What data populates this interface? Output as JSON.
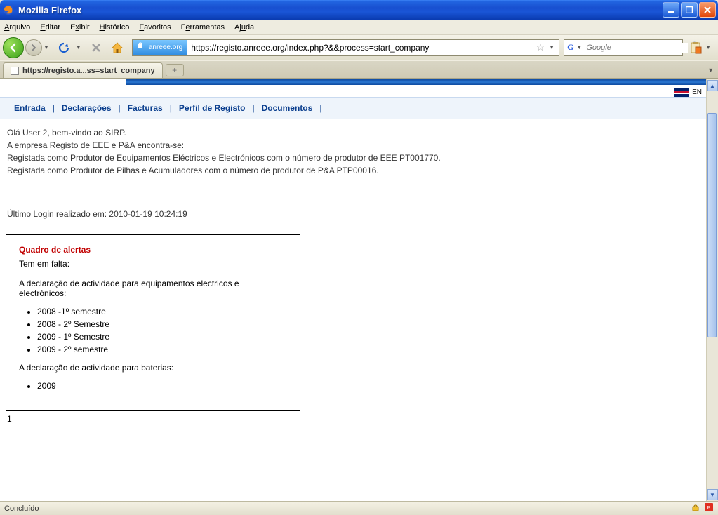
{
  "window": {
    "title": "Mozilla Firefox"
  },
  "menu": {
    "items": [
      "Arquivo",
      "Editar",
      "Exibir",
      "Histórico",
      "Favoritos",
      "Ferramentas",
      "Ajuda"
    ]
  },
  "toolbar": {
    "site_label": "anreee.org",
    "url": "https://registo.anreee.org/index.php?&&process=start_company",
    "search_placeholder": "Google"
  },
  "tab": {
    "title": "https://registo.a...ss=start_company"
  },
  "lang": {
    "code": "EN"
  },
  "nav": {
    "items": [
      "Entrada",
      "Declarações",
      "Facturas",
      "Perfil de Registo",
      "Documentos"
    ]
  },
  "content": {
    "greeting": "Olá User 2, bem-vindo ao SIRP.",
    "line1": "A empresa Registo de EEE e P&A encontra-se:",
    "line2": "Registada como Produtor de Equipamentos Eléctricos e Electrónicos com o número de produtor de EEE PT001770.",
    "line3": "Registada como Produtor de Pilhas e Acumuladores com o número de produtor de P&A PTP00016.",
    "last_login": "Último Login realizado em: 2010-01-19 10:24:19"
  },
  "alerts": {
    "title": "Quadro de alertas",
    "missing_label": "Tem em falta:",
    "section1_label": "A declaração de actividade para equipamentos electricos e electrónicos:",
    "section1_items": [
      "2008 -1º semestre",
      "2008 - 2º Semestre",
      "2009 - 1º Semestre",
      "2009 - 2º semestre"
    ],
    "section2_label": "A declaração de actividade para baterias:",
    "section2_items": [
      "2009"
    ]
  },
  "footer_num": "1",
  "status": {
    "text": "Concluído"
  }
}
